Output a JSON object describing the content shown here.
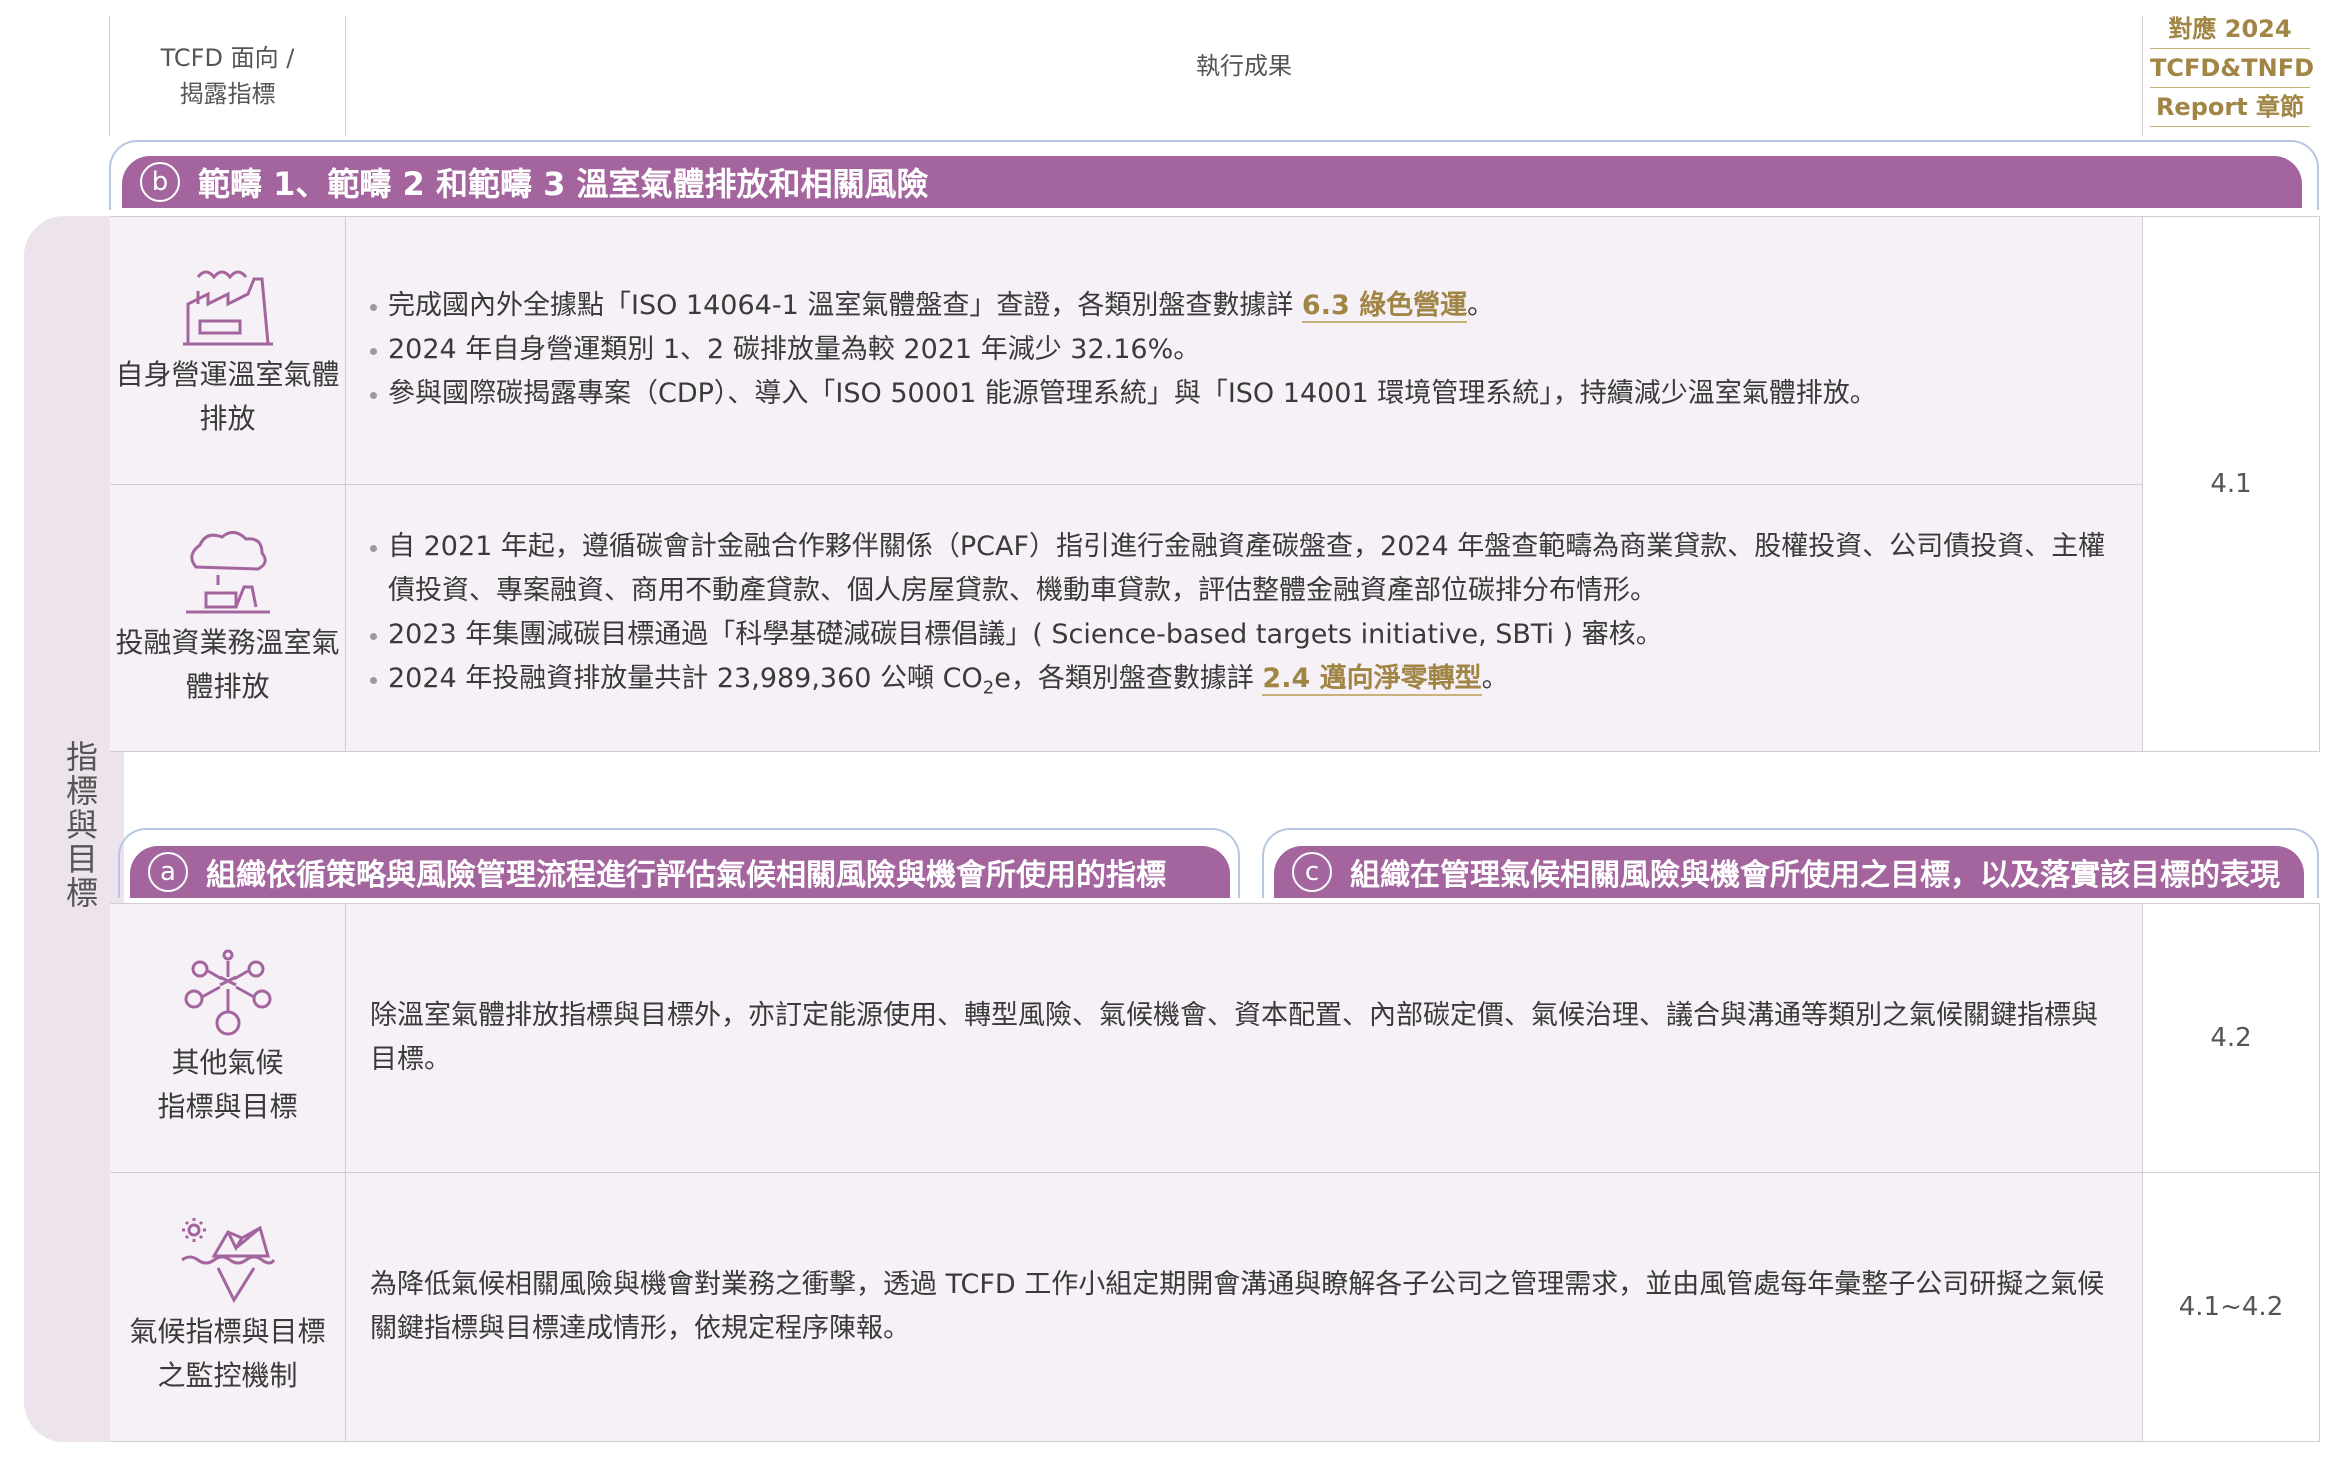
{
  "header": {
    "col1_line1": "TCFD 面向 /",
    "col1_line2": "揭露指標",
    "col2": "執行成果",
    "col3_line1": "對應 2024",
    "col3_line2": "TCFD&TNFD",
    "col3_line3": "Report 章節"
  },
  "left_tab": {
    "label": "指標與目標"
  },
  "section_b": {
    "badge": "b",
    "title": "範疇 1、範疇 2 和範疇 3 溫室氣體排放和相關風險"
  },
  "section_a": {
    "badge": "a",
    "title": "組織依循策略與風險管理流程進行評估氣候相關風險與機會所使用的指標"
  },
  "section_c": {
    "badge": "c",
    "title": "組織在管理氣候相關風險與機會所使用之目標，以及落實該目標的表現"
  },
  "rows": [
    {
      "label": "自身營運溫室氣體排放",
      "bullets": [
        {
          "pre": "完成國內外全據點「ISO 14064-1 溫室氣體盤查」查證，各類別盤查數據詳 ",
          "link": "6.3 綠色營運",
          "post": "。"
        },
        {
          "text": "2024 年自身營運類別 1、2 碳排放量為較 2021 年減少 32.16%。"
        },
        {
          "text": "參與國際碳揭露專案（CDP）、導入「ISO 50001 能源管理系統」與「ISO 14001 環境管理系統」，持續減少溫室氣體排放。"
        }
      ]
    },
    {
      "label": "投融資業務溫室氣體排放",
      "bullets": [
        {
          "text": "自 2021 年起，遵循碳會計金融合作夥伴關係（PCAF）指引進行金融資產碳盤查，2024 年盤查範疇為商業貸款、股權投資、公司債投資、主權債投資、專案融資、商用不動產貸款、個人房屋貸款、機動車貸款，評估整體金融資產部位碳排分布情形。"
        },
        {
          "text": "2023 年集團減碳目標通過「科學基礎減碳目標倡議」( Science-based targets initiative, SBTi ) 審核。"
        },
        {
          "pre": "2024 年投融資排放量共計 23,989,360 公噸 CO",
          "sub": "2",
          "mid": "e，各類別盤查數據詳 ",
          "link": "2.4 邁向淨零轉型",
          "post": "。"
        }
      ],
      "ref": "4.1"
    },
    {
      "label_line1": "其他氣候",
      "label_line2": "指標與目標",
      "text": "除溫室氣體排放指標與目標外，亦訂定能源使用、轉型風險、氣候機會、資本配置、內部碳定價、氣候治理、議合與溝通等類別之氣候關鍵指標與目標。",
      "ref": "4.2"
    },
    {
      "label_line1": "氣候指標與目標",
      "label_line2": "之監控機制",
      "text": "為降低氣候相關風險與機會對業務之衝擊，透過 TCFD 工作小組定期開會溝通與瞭解各子公司之管理需求，並由風管處每年彙整子公司研擬之氣候關鍵指標與目標達成情形，依規定程序陳報。",
      "ref": "4.1~4.2"
    }
  ],
  "colors": {
    "accent": "#a4659f",
    "row_bg": "#f6f1f6",
    "link": "#a08545",
    "frame": "#b7c7e0"
  },
  "icons": [
    "factory-icon",
    "cloud-factory-icon",
    "network-nodes-icon",
    "iceberg-icon"
  ]
}
